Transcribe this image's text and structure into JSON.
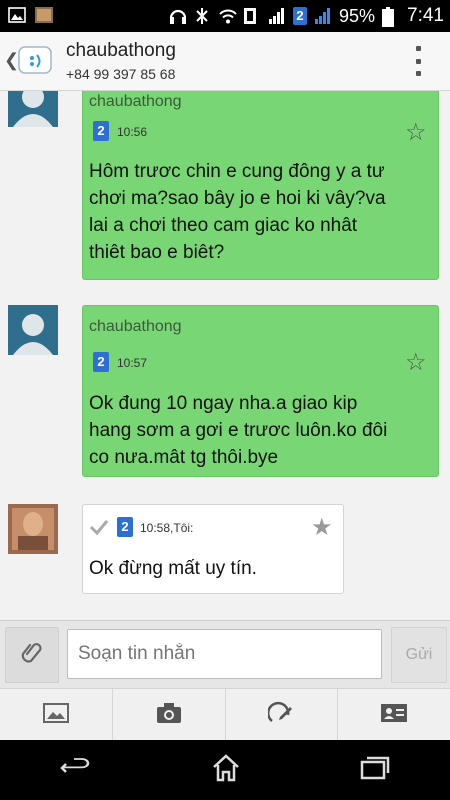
{
  "status_bar": {
    "battery_percent": "95%",
    "time": "7:41",
    "sim_badge": "2"
  },
  "header": {
    "contact_name": "chaubathong",
    "phone_number": "+84 99 397 85 68"
  },
  "messages": [
    {
      "sender": "chaubathong",
      "sim": "2",
      "time": "10:56",
      "text_lines": [
        "Hôm trươc chin e cung đông y a tư",
        "chơi ma?sao bây jo e hoi ki vây?va",
        "lai a chơi theo cam giac ko nhât",
        "thiêt bao e biêt?"
      ]
    },
    {
      "sender": "chaubathong",
      "sim": "2",
      "time": "10:57",
      "text_lines": [
        "Ok đung 10 ngay nha.a giao kip",
        "hang sơm a gơi e trươc luôn.ko đôi",
        "co nưa.mât tg thôi.bye"
      ]
    },
    {
      "sim": "2",
      "time": "10:58,Tôi:",
      "text_lines": [
        "Ok đừng mất uy tín."
      ]
    }
  ],
  "composer": {
    "placeholder": "Soạn tin nhắn",
    "send_label": "Gửi"
  },
  "colors": {
    "incoming_bubble": "#79d675",
    "outgoing_bubble": "#ffffff",
    "sim_badge": "#2d6fd2"
  }
}
